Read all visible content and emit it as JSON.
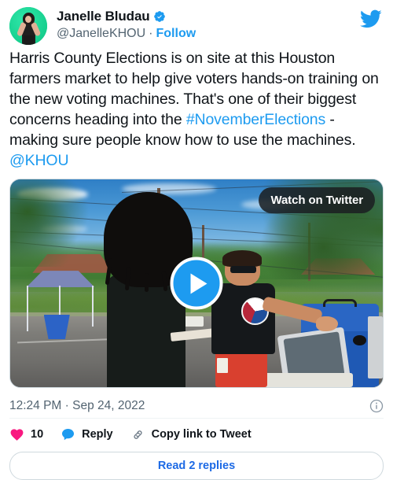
{
  "header": {
    "display_name": "Janelle Bludau",
    "verified_badge": "verified-icon",
    "handle": "@JanelleKHOU",
    "separator": "·",
    "follow_label": "Follow",
    "brand_icon": "twitter-bird-icon",
    "avatar_alt": "Janelle Bludau profile photo"
  },
  "tweet": {
    "text_part_1": "Harris County Elections is on site at this Houston farmers market to help give voters hands-on training on the new voting machines. That's one of their biggest concerns heading into the ",
    "hashtag": "#NovemberElections",
    "text_part_2": " - making sure people know how to use the machines. ",
    "mention": "@KHOU"
  },
  "media": {
    "type": "video",
    "watch_label": "Watch on Twitter",
    "play_icon": "play-icon",
    "alt": "Election worker demonstrating a voting machine to a voter at an outdoor farmers market parking lot"
  },
  "meta": {
    "timestamp": "12:24 PM · Sep 24, 2022",
    "info_icon": "info-circle-icon"
  },
  "actions": {
    "like": {
      "icon": "heart-icon",
      "count": "10"
    },
    "reply": {
      "icon": "reply-bubble-icon",
      "label": "Reply"
    },
    "copy_link": {
      "icon": "link-icon",
      "label": "Copy link to Tweet"
    }
  },
  "read_replies": {
    "label": "Read 2 replies"
  },
  "colors": {
    "accent_blue": "#1d9bf0",
    "link_blue": "#1d6ae5",
    "like_pink": "#f91880",
    "text_primary": "#0f1419",
    "text_secondary": "#536471",
    "border": "#cfd9de",
    "divider": "#eff3f4",
    "badge_bg": "#1b1e22"
  }
}
